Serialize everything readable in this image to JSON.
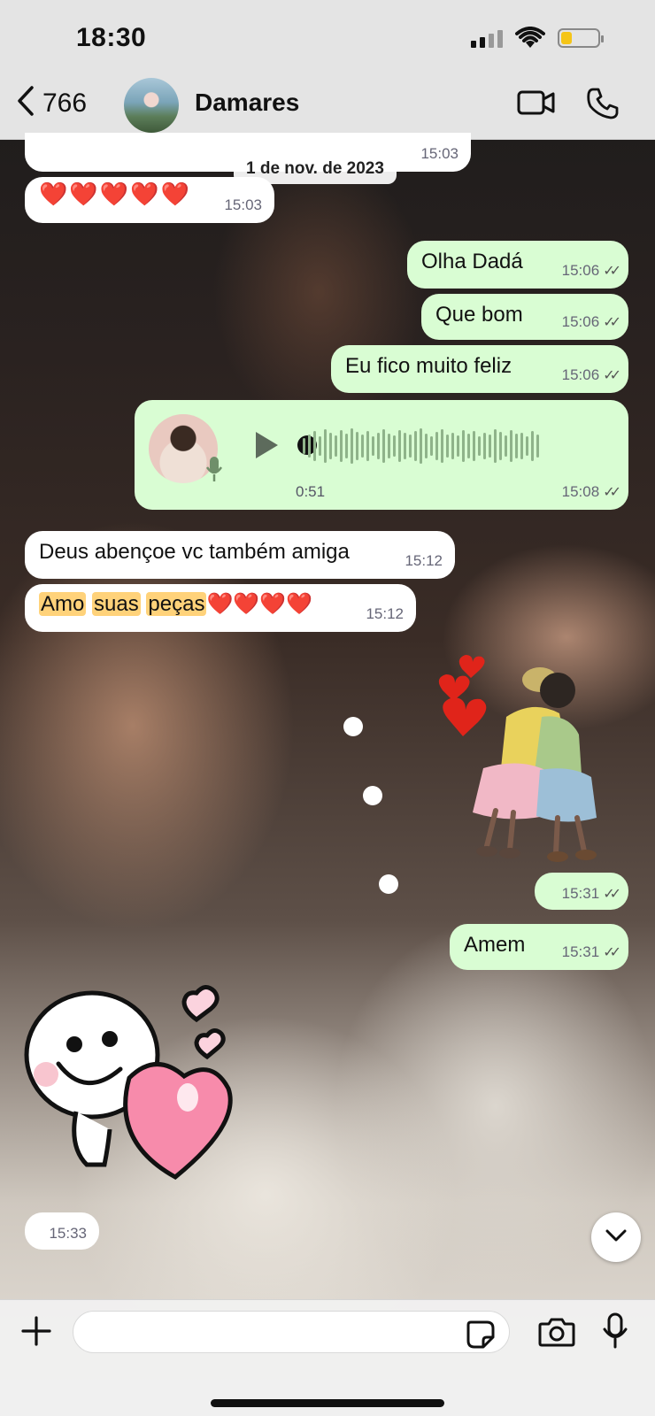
{
  "status_bar": {
    "time": "18:30"
  },
  "header": {
    "back_count": "766",
    "contact_name": "Damares"
  },
  "date_separator": "1 de nov. de 2023",
  "messages": [
    {
      "dir": "in",
      "text": "",
      "time": "15:03"
    },
    {
      "dir": "in",
      "text": "❤️❤️❤️❤️❤️",
      "time": "15:03"
    },
    {
      "dir": "out",
      "text": "Olha Dadá",
      "time": "15:06"
    },
    {
      "dir": "out",
      "text": "Que bom",
      "time": "15:06"
    },
    {
      "dir": "out",
      "text": "Eu fico muito feliz",
      "time": "15:06"
    },
    {
      "dir": "out",
      "type": "voice",
      "duration": "0:51",
      "time": "15:08"
    },
    {
      "dir": "in",
      "text": "Deus abençoe vc também amiga",
      "time": "15:12"
    },
    {
      "dir": "in",
      "text_parts": [
        "Amo",
        "suas",
        "peças"
      ],
      "hearts": "❤️❤️❤️❤️",
      "time": "15:12"
    },
    {
      "dir": "out",
      "type": "sticker",
      "time": "15:31"
    },
    {
      "dir": "out",
      "text": "Amem",
      "time": "15:31"
    },
    {
      "dir": "in",
      "type": "sticker",
      "time": "15:33"
    }
  ],
  "input": {
    "placeholder": ""
  },
  "colors": {
    "outgoing_bubble": "#d9fdd3",
    "incoming_bubble": "#ffffff",
    "highlight": "#ffd27a",
    "heart": "#e0142a"
  },
  "icons": [
    "chevron-left-icon",
    "video-icon",
    "phone-icon",
    "play-icon",
    "mic-icon",
    "plus-icon",
    "sticker-icon",
    "camera-icon",
    "chevron-down-icon"
  ]
}
